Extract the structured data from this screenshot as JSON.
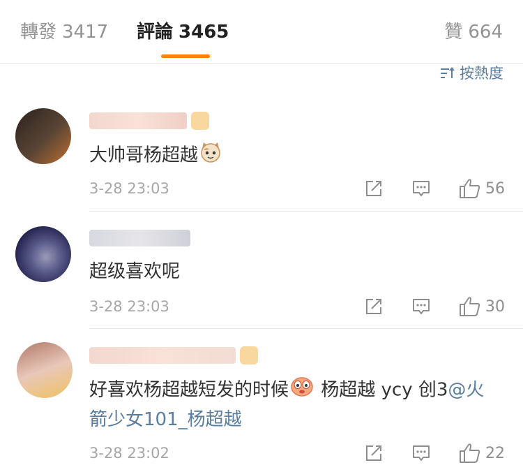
{
  "tabs": [
    {
      "label": "轉發",
      "count": "3417"
    },
    {
      "label": "評論",
      "count": "3465"
    },
    {
      "label": "贊",
      "count": "664"
    }
  ],
  "sort": {
    "label": "按熱度",
    "icon": "sort-icon"
  },
  "accent_color": "#ff8200",
  "link_color": "#5b7ea0",
  "comments": [
    {
      "text": "大帅哥杨超越",
      "emoji": "cat-emoji-icon",
      "time": "3-28 23:03",
      "likes": "56",
      "avatar_colors": [
        "#3b2f2a",
        "#6a5040",
        "#c07030"
      ]
    },
    {
      "text": "超级喜欢呢",
      "time": "3-28 23:03",
      "likes": "30",
      "avatar_colors": [
        "#2a2950",
        "#5a5a8a",
        "#9a9ab8"
      ]
    },
    {
      "text_before": "好喜欢杨超越短发的时候",
      "emoji": "blush-emoji-icon",
      "text_after": " 杨超越 ycy 创3",
      "mention": "@火箭少女101_杨超越",
      "time": "3-28 23:02",
      "likes": "22",
      "avatar_colors": [
        "#c49a8a",
        "#e8c8b8",
        "#a07060"
      ]
    }
  ]
}
